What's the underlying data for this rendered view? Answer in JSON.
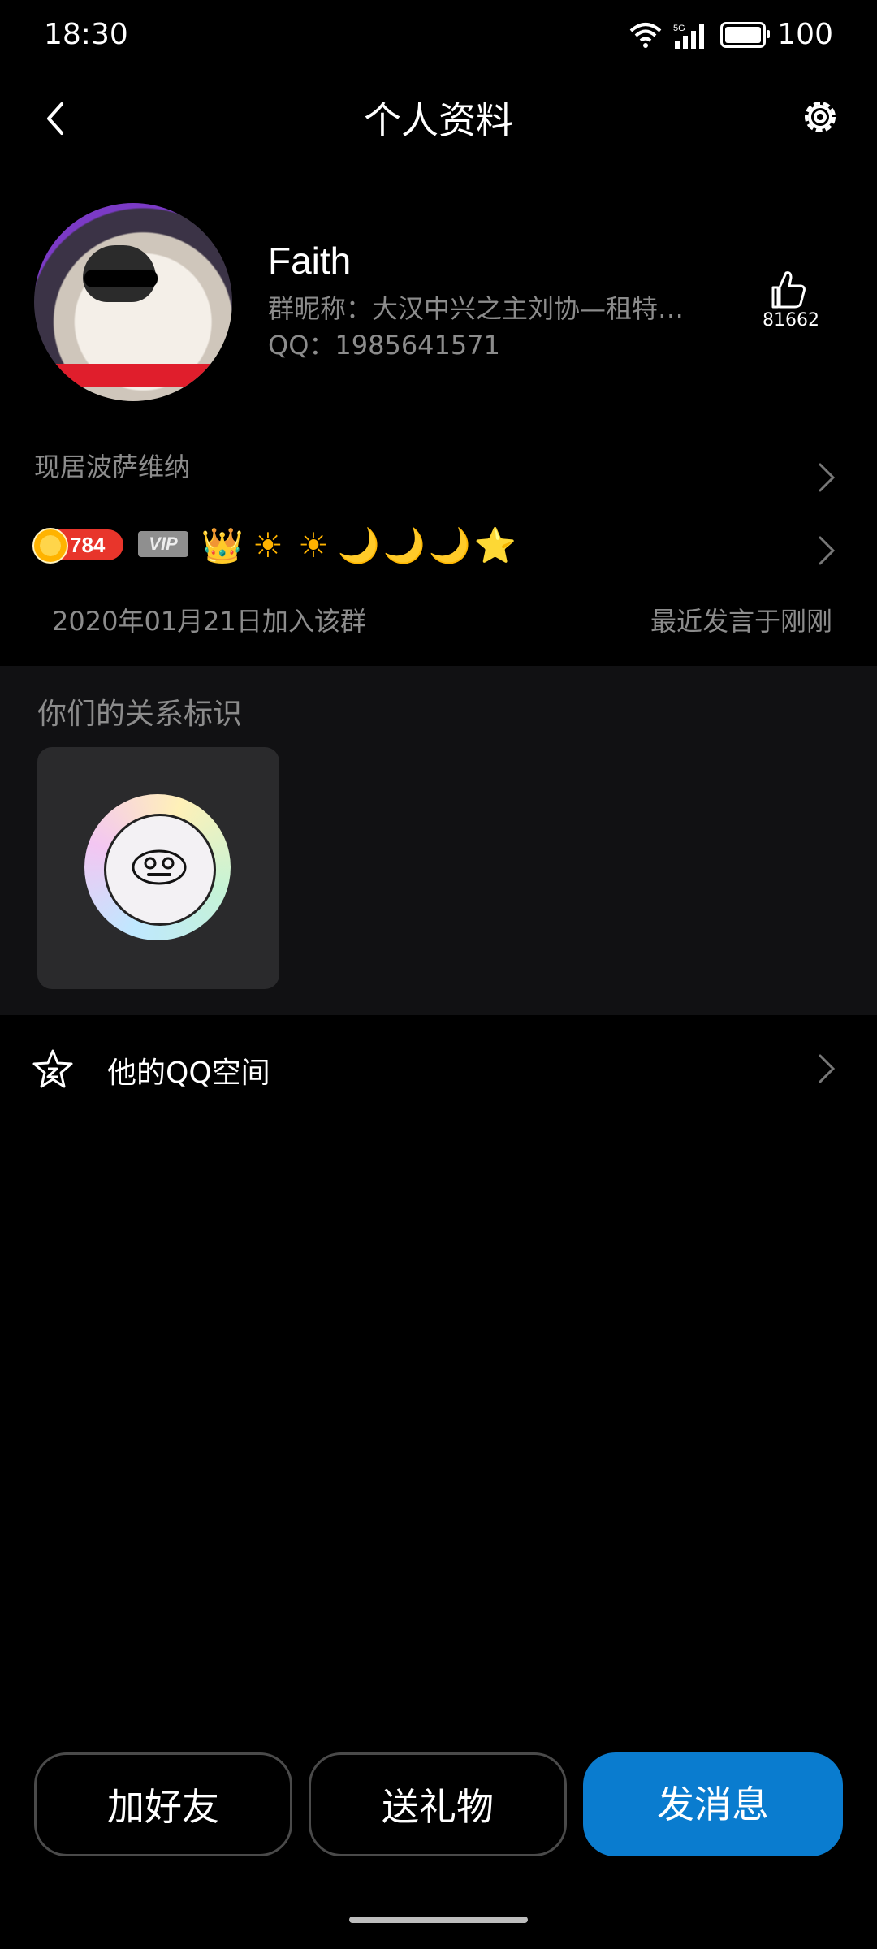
{
  "status_bar": {
    "time": "18:30",
    "network": "5G",
    "battery": "100"
  },
  "header": {
    "title": "个人资料",
    "back_icon": "chevron-left-icon",
    "settings_icon": "gear-icon"
  },
  "profile": {
    "name": "Faith",
    "group_nickname": "群昵称：大汉中兴之主刘协—租特…",
    "qq": "QQ：1985641571",
    "like_count": "81662"
  },
  "location": {
    "text": "现居波萨维纳"
  },
  "badges": {
    "level": "784",
    "vip": "VIP",
    "icons": [
      "👑",
      "☀",
      "☀",
      "🌙",
      "🌙",
      "🌙",
      "⭐"
    ]
  },
  "group_info": {
    "joined": "2020年01月21日加入该群",
    "last_speak": "最近发言于刚刚"
  },
  "relation": {
    "title": "你们的关系标识"
  },
  "qzone": {
    "label": "他的QQ空间"
  },
  "actions": {
    "add_friend": "加好友",
    "send_gift": "送礼物",
    "send_message": "发消息"
  },
  "colors": {
    "background": "#000000",
    "primary": "#0a7ccf",
    "secondary_text": "#8c8c8c",
    "section_bg": "#111113"
  }
}
